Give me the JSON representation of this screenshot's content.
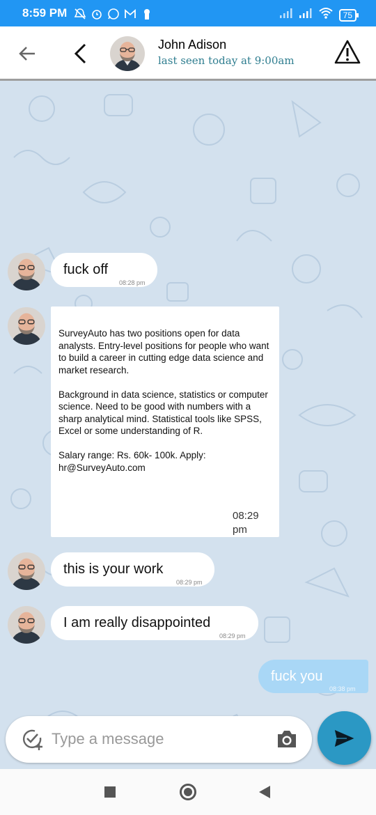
{
  "status_bar": {
    "time": "8:59 PM",
    "battery": "75",
    "icons": [
      "mute-icon",
      "alarm-icon",
      "whatsapp-icon",
      "gmail-icon",
      "keyhole-icon",
      "signal-icon",
      "signal-icon",
      "wifi-icon",
      "battery-icon"
    ]
  },
  "header": {
    "contact_name": "John Adison",
    "last_seen": "last seen today at 9:00am"
  },
  "messages": [
    {
      "direction": "incoming",
      "text": "fuck off",
      "time": "08:28 pm"
    },
    {
      "direction": "incoming",
      "text": "SurveyAuto has two positions open for data analysts. Entry-level positions for people who want to build a career in cutting edge data science and market research.\n\nBackground in data science, statistics or computer science. Need to be good with numbers with a sharp analytical mind. Statistical tools like SPSS, Excel or some understanding of R.\n\nSalary range: Rs. 60k- 100k. Apply: hr@SurveyAuto.com",
      "time": "08:29 pm"
    },
    {
      "direction": "incoming",
      "text": "this is your work",
      "time": "08:29 pm"
    },
    {
      "direction": "incoming",
      "text": "I am really disappointed",
      "time": "08:29 pm"
    },
    {
      "direction": "outgoing",
      "text": "fuck you",
      "time": "08:38 pm"
    }
  ],
  "composer": {
    "placeholder": "Type a message"
  },
  "colors": {
    "status_bar": "#2196f3",
    "chat_background": "#d3e1ee",
    "outgoing_bubble": "#a9d7f6",
    "send_button": "#2b98c4",
    "last_seen_text": "#2e7d8f"
  }
}
